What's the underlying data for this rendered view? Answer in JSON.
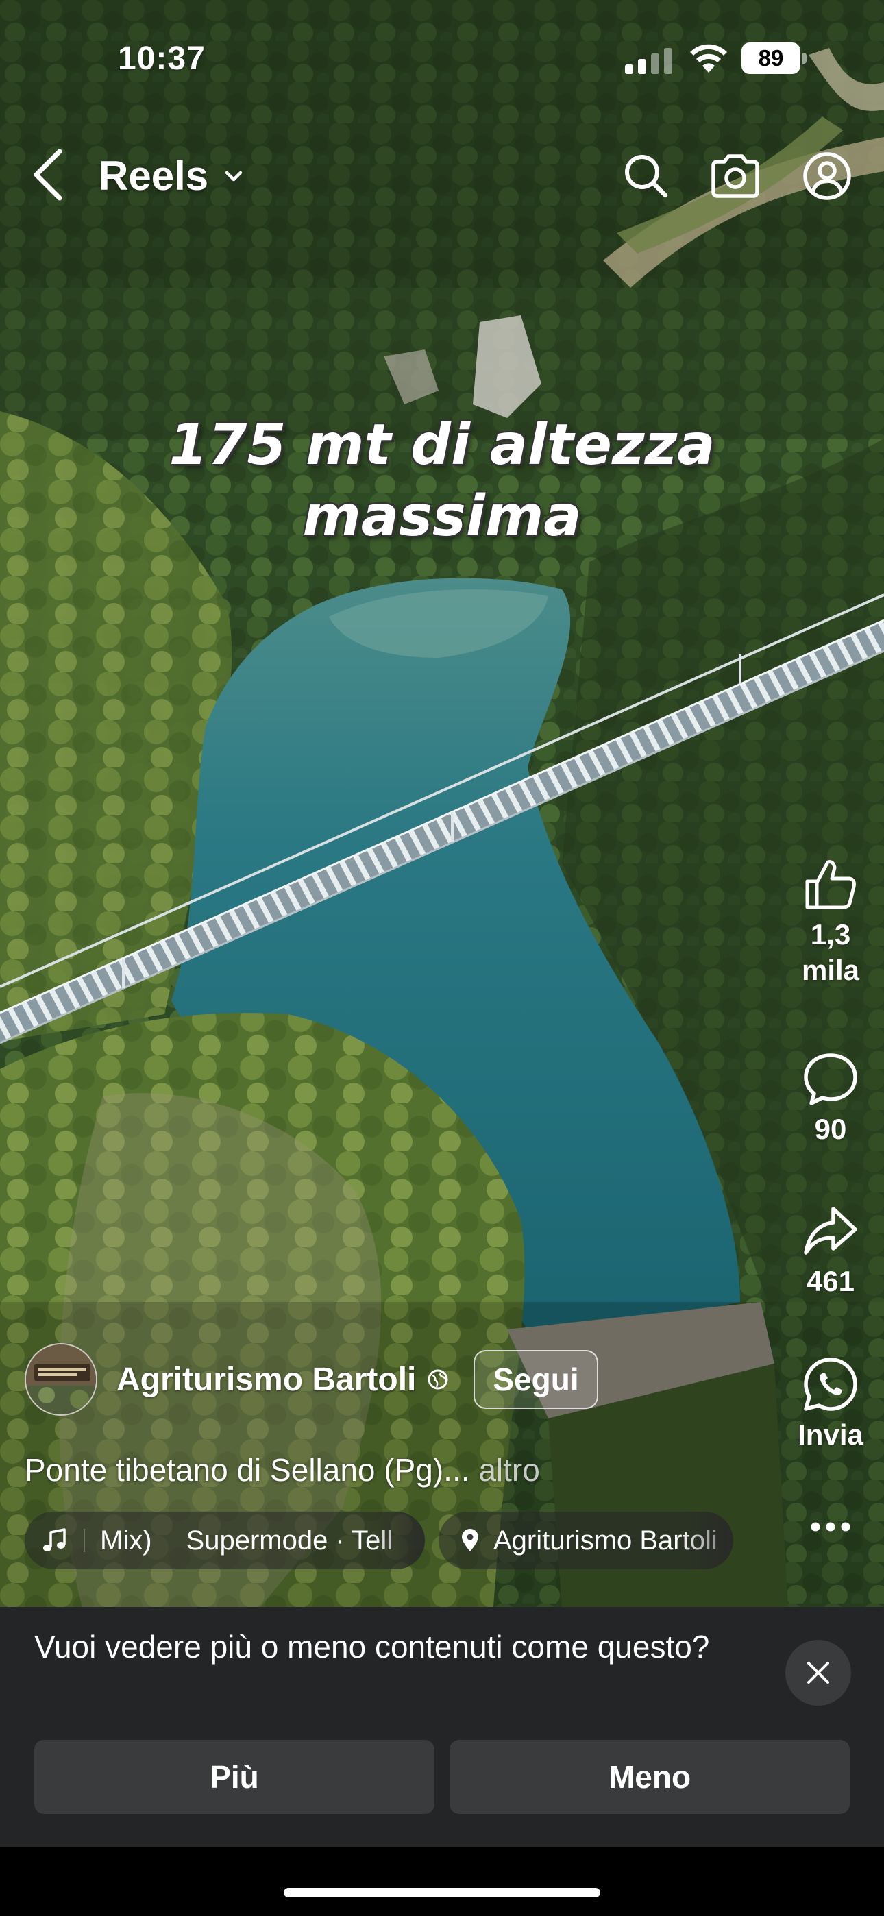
{
  "status_bar": {
    "time": "10:37",
    "battery": "89"
  },
  "nav": {
    "title": "Reels",
    "icons": [
      "back-icon",
      "chevron-down-icon",
      "search-icon",
      "camera-icon",
      "profile-icon"
    ]
  },
  "overlay_caption": {
    "line1": "175 mt di altezza",
    "line2": "massima"
  },
  "actions": {
    "likes_line1": "1,3",
    "likes_line2": "mila",
    "comments": "90",
    "shares": "461",
    "whatsapp_label": "Invia"
  },
  "author": {
    "name": "Agriturismo Bartoli",
    "follow_label": "Segui"
  },
  "post": {
    "description": "Ponte tibetano di Sellano (Pg)...",
    "more_label": "altro"
  },
  "chips": {
    "music_a": "Mix)",
    "music_b": "Supermode · Tell",
    "location": "Agriturismo Bartoli"
  },
  "feedback": {
    "question": "Vuoi vedere più o meno contenuti come questo?",
    "more_label": "Più",
    "less_label": "Meno"
  },
  "colors": {
    "panel": "#242526",
    "button": "#3a3b3c",
    "water": "#1f6d78",
    "forest": "#2f4a22"
  }
}
